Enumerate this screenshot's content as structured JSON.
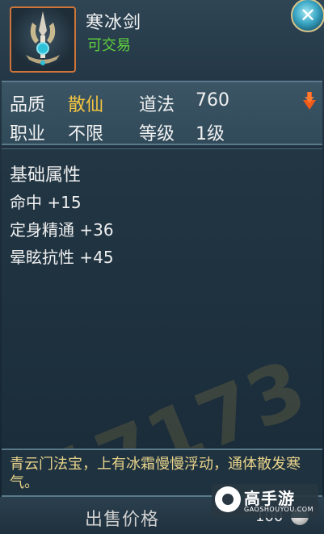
{
  "item": {
    "name": "寒冰剑",
    "trade_status": "可交易"
  },
  "stats": {
    "quality_label": "品质",
    "quality_value": "散仙",
    "daofa_label": "道法",
    "daofa_value": "760",
    "class_label": "职业",
    "class_value": "不限",
    "level_label": "等级",
    "level_value": "1级"
  },
  "attributes": {
    "title": "基础属性",
    "rows": [
      "命中 +15",
      "定身精通 +36",
      "晕眩抗性 +45"
    ]
  },
  "description": "青云门法宝，上有冰霜慢慢浮动，通体散发寒气。",
  "footer": {
    "sell_label": "出售价格",
    "sell_value": "100"
  },
  "watermark": {
    "text": "17173"
  },
  "logo": {
    "name": "高手游",
    "domain": "GAOSHOUYOU.COM"
  },
  "colors": {
    "quality": "#f2c440",
    "trade": "#5fd23c",
    "description": "#e9d48a",
    "frame": "#d0753a"
  },
  "icons": [
    "sword-item-icon",
    "close-icon",
    "arrow-down-icon",
    "coin-icon"
  ]
}
